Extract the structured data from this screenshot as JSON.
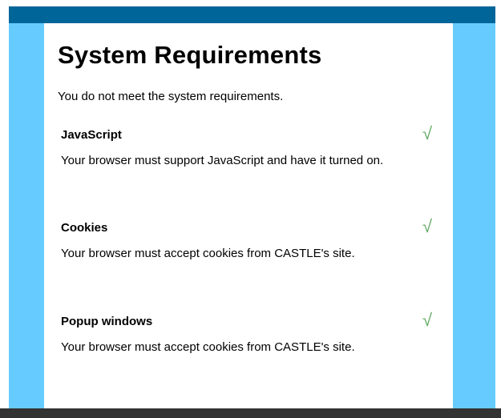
{
  "page": {
    "title": "System Requirements",
    "status_message": "You do not meet the system requirements."
  },
  "requirements": [
    {
      "title": "JavaScript",
      "met": true,
      "check_symbol": "√",
      "description": "Your browser must support JavaScript and have it turned on."
    },
    {
      "title": "Cookies",
      "met": true,
      "check_symbol": "√",
      "description": "Your browser must accept cookies from CASTLE's site."
    },
    {
      "title": "Popup windows",
      "met": true,
      "check_symbol": "√",
      "description": "Your browser must accept cookies from CASTLE's site."
    }
  ],
  "colors": {
    "top_bar": "#006699",
    "side_panels": "#66ccff",
    "bottom_bar": "#333333",
    "check_mark": "#66aa66"
  }
}
